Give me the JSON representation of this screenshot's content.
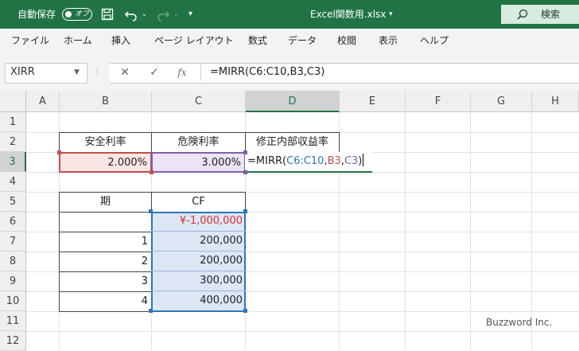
{
  "title_bar": {
    "autosave_label": "自動保存",
    "toggle_state": "オフ",
    "file_name": "Excel関数用.xlsx",
    "search_label": "検索"
  },
  "ribbon_tabs": [
    "ファイル",
    "ホーム",
    "挿入",
    "ページ レイアウト",
    "数式",
    "データ",
    "校閲",
    "表示",
    "ヘルプ"
  ],
  "formula_bar": {
    "name_box": "XIRR",
    "formula": "=MIRR(C6:C10,B3,C3)"
  },
  "columns": [
    "A",
    "B",
    "C",
    "D",
    "E",
    "F",
    "G",
    "H"
  ],
  "rows": [
    "1",
    "2",
    "3",
    "4",
    "5",
    "6",
    "7",
    "8",
    "9",
    "10",
    "11",
    "12"
  ],
  "cells": {
    "B2": "安全利率",
    "C2": "危険利率",
    "D2": "修正内部収益率",
    "B3": "2.000%",
    "C3": "3.000%",
    "D3_prefix": "=MIRR(",
    "D3_ref1": "C6:C10",
    "D3_comma1": ",",
    "D3_ref2": "B3",
    "D3_comma2": ",",
    "D3_ref3": "C3",
    "D3_suffix": ")",
    "B5": "期",
    "C5": "CF",
    "C6": "¥-1,000,000",
    "B7": "1",
    "C7": "200,000",
    "B8": "2",
    "C8": "200,000",
    "B9": "3",
    "C9": "300,000",
    "B10": "4",
    "C10": "400,000"
  },
  "watermark": "Buzzword Inc.",
  "colors": {
    "excel_green": "#217346",
    "ref_blue": "#2e75b6",
    "ref_red": "#c0504d",
    "ref_purple": "#7f5fa8",
    "negative": "#d9322e"
  }
}
